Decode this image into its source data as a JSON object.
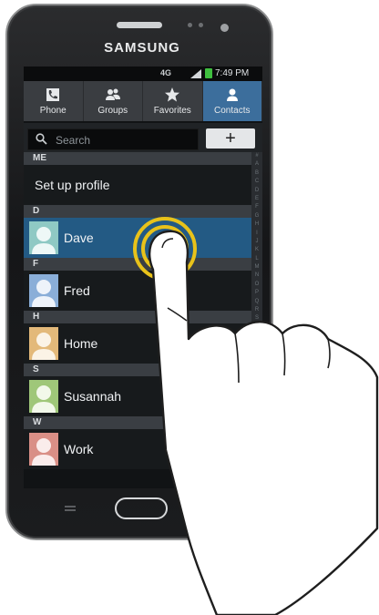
{
  "device": {
    "brand": "SAMSUNG"
  },
  "status_bar": {
    "network": "4G",
    "time": "7:49 PM"
  },
  "tabs": [
    {
      "label": "Phone",
      "icon": "phone-icon"
    },
    {
      "label": "Groups",
      "icon": "groups-icon"
    },
    {
      "label": "Favorites",
      "icon": "star-icon"
    },
    {
      "label": "Contacts",
      "icon": "contact-icon",
      "active": true
    }
  ],
  "search": {
    "placeholder": "Search",
    "add_label": "+"
  },
  "sections": [
    {
      "header": "ME",
      "rows": [
        {
          "label": "Set up profile"
        }
      ]
    },
    {
      "header": "D",
      "rows": [
        {
          "label": "Dave",
          "selected": true,
          "avatar_color": "#8fc9c4"
        }
      ]
    },
    {
      "header": "F",
      "rows": [
        {
          "label": "Fred",
          "avatar_color": "#8aaed8"
        }
      ]
    },
    {
      "header": "H",
      "rows": [
        {
          "label": "Home",
          "avatar_color": "#e3b97a"
        }
      ]
    },
    {
      "header": "S",
      "rows": [
        {
          "label": "Susannah",
          "avatar_color": "#9fc779"
        }
      ]
    },
    {
      "header": "W",
      "rows": [
        {
          "label": "Work",
          "avatar_color": "#d98f86"
        }
      ]
    }
  ],
  "index_letters": [
    "#",
    "A",
    "B",
    "C",
    "D",
    "E",
    "F",
    "G",
    "H",
    "I",
    "J",
    "K",
    "L",
    "M",
    "N",
    "O",
    "P",
    "Q",
    "R",
    "S",
    "T",
    "U",
    "V",
    "W",
    "X",
    "Y",
    "Z"
  ],
  "colors": {
    "tab_active": "#3c6e9c",
    "row_selected": "#235a84",
    "touch_ring": "#e8c21a"
  }
}
